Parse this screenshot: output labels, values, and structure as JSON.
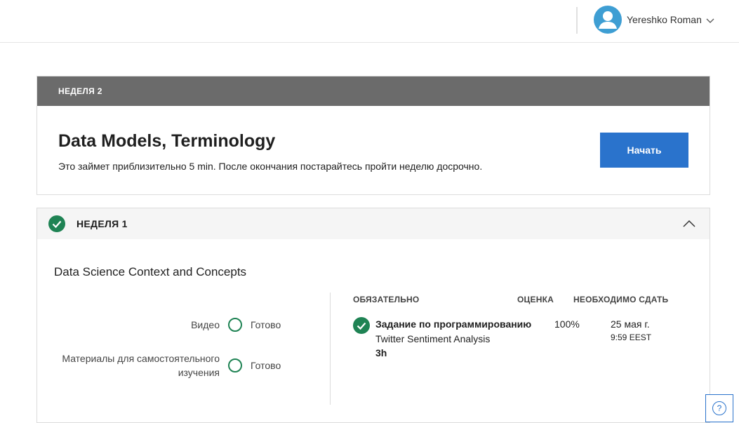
{
  "header": {
    "user_name": "Yereshko Roman",
    "avatar_icon": "user-avatar-icon",
    "dropdown_icon": "chevron-down-icon"
  },
  "week2": {
    "label": "НЕДЕЛЯ 2",
    "title": "Data Models, Terminology",
    "description": "Это займет приблизительно 5 min. После окончания постарайтесь пройти неделю досрочно.",
    "start_button": "Начать"
  },
  "week1": {
    "label": "НЕДЕЛЯ 1",
    "module_title": "Data Science Context and Concepts",
    "progress": [
      {
        "label": "Видео",
        "status": "Готово"
      },
      {
        "label": "Материалы для самостоятельного изучения",
        "status": "Готово"
      }
    ],
    "table_headers": {
      "required": "ОБЯЗАТЕЛЬНО",
      "grade": "ОЦЕНКА",
      "due": "НЕОБХОДИМО СДАТЬ"
    },
    "assignment": {
      "title": "Задание по программированию",
      "subtitle": "Twitter Sentiment Analysis",
      "duration": "3h",
      "grade": "100%",
      "due_date": "25 мая г.",
      "due_time": "9:59 EEST"
    }
  },
  "help": {
    "label": "?"
  },
  "colors": {
    "accent": "#2a73cc",
    "success": "#1f8354",
    "week_header": "#6b6b6b",
    "avatar": "#3e9ed3"
  }
}
